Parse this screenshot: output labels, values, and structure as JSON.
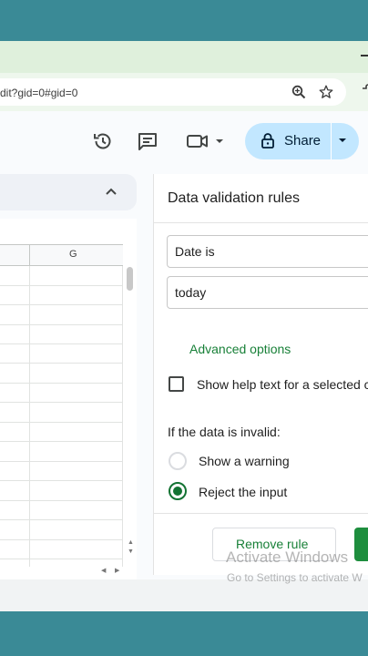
{
  "browser": {
    "url_fragment": "dit?gid=0#gid=0"
  },
  "toolbar": {
    "share_label": "Share"
  },
  "sheet": {
    "column_label": "G"
  },
  "panel": {
    "title": "Data validation rules",
    "criteria_value": "Date is",
    "date_value": "today",
    "advanced_options": "Advanced options",
    "help_text_label": "Show help text for a selected c",
    "help_text_checked": false,
    "invalid_label": "If the data is invalid:",
    "options": [
      {
        "label": "Show a warning",
        "selected": false
      },
      {
        "label": "Reject the input",
        "selected": true
      }
    ],
    "remove_rule": "Remove rule"
  },
  "watermark": {
    "line1": "Activate Windows",
    "line2": "Go to Settings to activate W"
  },
  "colors": {
    "accent_green": "#188038",
    "share_bg": "#c2e7ff",
    "frame_teal": "#3a8a96"
  },
  "icons": [
    "zoom-icon",
    "star-icon",
    "extension-icon",
    "history-icon",
    "comment-icon",
    "video-call-icon",
    "lock-icon",
    "chevron-up-icon"
  ]
}
